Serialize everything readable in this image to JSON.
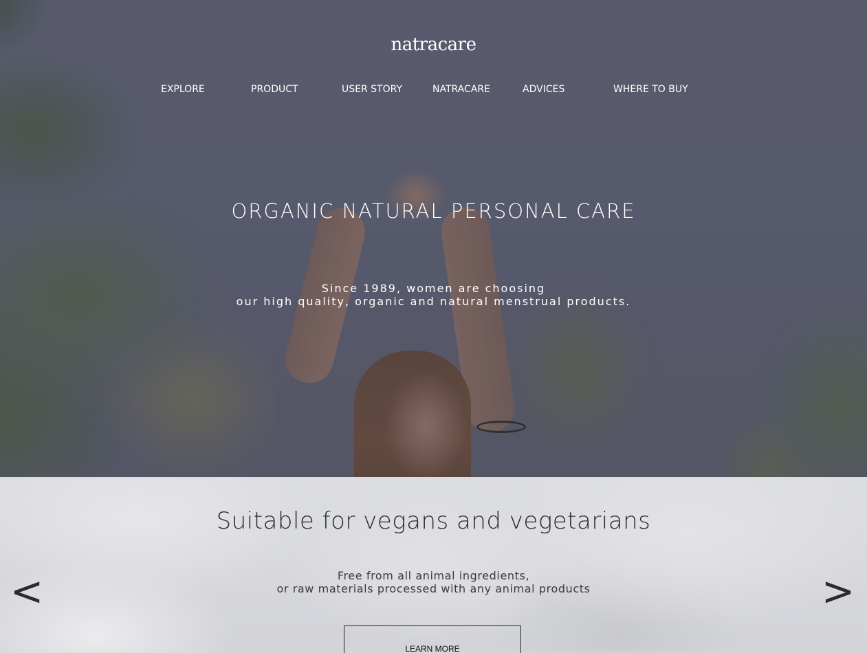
{
  "brand": {
    "logo_text": "natracare"
  },
  "nav": {
    "items": [
      {
        "label": "EXPLORE"
      },
      {
        "label": "PRODUCT"
      },
      {
        "label": "USER STORY"
      },
      {
        "label": "NATRACARE"
      },
      {
        "label": "ADVICES"
      },
      {
        "label": "WHERE TO BUY"
      }
    ]
  },
  "hero": {
    "title": "ORGANIC NATURAL PERSONAL CARE",
    "subtitle_line1": "Since 1989, women are choosing",
    "subtitle_line2": "our high quality, organic and natural menstrual products."
  },
  "slider": {
    "title": "Suitable for vegans and vegetarians",
    "text_line1": "Free from all animal ingredients,",
    "text_line2": "or raw materials processed with any animal products",
    "button_label": "LEARN MORE",
    "prev_label": "<",
    "next_label": ">"
  },
  "colors": {
    "hero_overlay": "#5b5e70",
    "slider_background": "#d8d9de",
    "text_light": "#ffffff",
    "text_dark": "#2a2a2d"
  }
}
